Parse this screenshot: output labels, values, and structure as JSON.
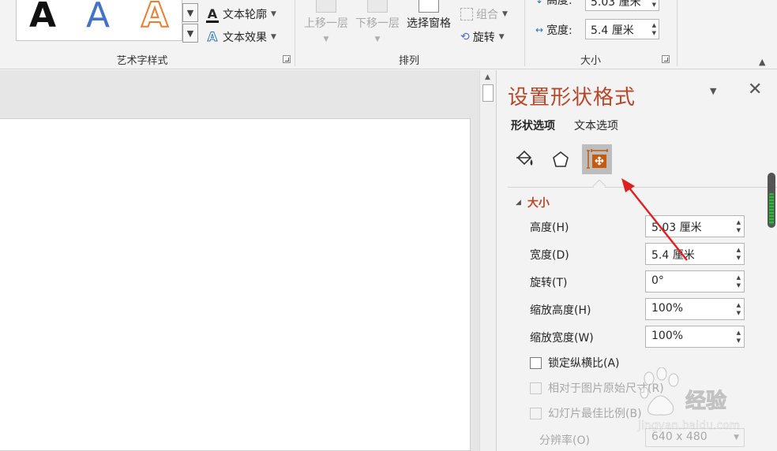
{
  "ribbon": {
    "wordart_group": {
      "label": "艺术字样式",
      "gallery_glyphs": [
        "A",
        "A",
        "A"
      ],
      "text_outline": "文本轮廓",
      "text_effect": "文本效果"
    },
    "arrange_group": {
      "label": "排列",
      "bring_forward": "上移一层",
      "send_backward": "下移一层",
      "selection_pane": "选择窗格",
      "group": "组合",
      "rotate": "旋转"
    },
    "size_group": {
      "label": "大小",
      "height_label": "高度:",
      "height_value": "5.03 厘米",
      "width_label": "宽度:",
      "width_value": "5.4 厘米"
    }
  },
  "pane": {
    "title": "设置形状格式",
    "tabs": [
      "形状选项",
      "文本选项"
    ],
    "category_icons": [
      "fill-line-icon",
      "effects-icon",
      "size-properties-icon"
    ],
    "section_title": "大小",
    "fields": [
      {
        "label": "高度(H)",
        "value": "5.03 厘米"
      },
      {
        "label": "宽度(D)",
        "value": "5.4 厘米"
      },
      {
        "label": "旋转(T)",
        "value": "0°"
      },
      {
        "label": "缩放高度(H)",
        "value": "100%"
      },
      {
        "label": "缩放宽度(W)",
        "value": "100%"
      }
    ],
    "lock_aspect": "锁定纵横比(A)",
    "relative_original": "相对于图片原始尺寸(R)",
    "best_scale": "幻灯片最佳比例(B)",
    "resolution_label": "分辨率(O)",
    "resolution_value": "640 x 480"
  },
  "watermark": {
    "name": "经验",
    "url": "jingyan.baidu.com"
  },
  "colors": {
    "accent": "#b7472a",
    "annotation_arrow": "#e02020"
  }
}
